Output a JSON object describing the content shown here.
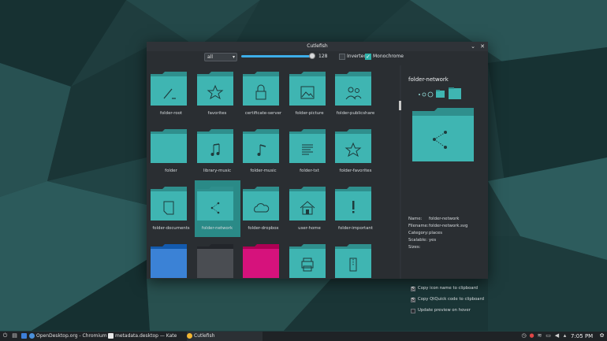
{
  "window": {
    "title": "Cutlefish",
    "minimize_glyph": "⌄",
    "close_glyph": "✕"
  },
  "toolbar": {
    "category_select": "all",
    "size_value": "128",
    "inverted_label": "Inverted",
    "inverted_checked": false,
    "monochrome_label": "Monochrome",
    "monochrome_checked": true
  },
  "icons": [
    {
      "label": "folder-root",
      "glyph": "slash"
    },
    {
      "label": "favorites",
      "glyph": "star"
    },
    {
      "label": "certificate-server",
      "glyph": "lock"
    },
    {
      "label": "folder-picture",
      "glyph": "picture"
    },
    {
      "label": "folder-publicshare",
      "glyph": "people"
    },
    {
      "label": "folder",
      "glyph": "none"
    },
    {
      "label": "library-music",
      "glyph": "note"
    },
    {
      "label": "folder-music",
      "glyph": "note2"
    },
    {
      "label": "folder-txt",
      "glyph": "lines"
    },
    {
      "label": "folder-favorites",
      "glyph": "star"
    },
    {
      "label": "folder-documents",
      "glyph": "doc"
    },
    {
      "label": "folder-network",
      "glyph": "network",
      "selected": true
    },
    {
      "label": "folder-dropbox",
      "glyph": "cloud"
    },
    {
      "label": "user-home",
      "glyph": "home"
    },
    {
      "label": "folder-important",
      "glyph": "exclaim"
    },
    {
      "label": "",
      "glyph": "none",
      "color": "#3b82d6"
    },
    {
      "label": "",
      "glyph": "none",
      "color": "#4a4d52"
    },
    {
      "label": "",
      "glyph": "none",
      "color": "#d6127c"
    },
    {
      "label": "",
      "glyph": "printer"
    },
    {
      "label": "",
      "glyph": "zip"
    }
  ],
  "preview": {
    "title": "folder-network",
    "name_key": "Name:",
    "name_val": "folder-network",
    "filename_key": "Filename:",
    "filename_val": "folder-network.svg",
    "category_key": "Category:",
    "category_val": "places",
    "scalable_key": "Scalable:",
    "scalable_val": "yes",
    "sizes_key": "Sizes:",
    "sizes_val": "",
    "copy_name_label": "Copy icon name to clipboard",
    "copy_qtquick_label": "Copy QtQuick code to clipboard",
    "update_hover_label": "Update preview on hover"
  },
  "taskbar": {
    "task1": "OpenDesktop.org - Chromium",
    "task2": "metadata.desktop — Kate",
    "task3": "Cutlefish",
    "clock": "7:05 PM"
  },
  "colors": {
    "folder_teal": "#3fb5b2",
    "folder_tab": "#2f8f8d",
    "accent": "#3daee9",
    "selection": "#2a8a87"
  }
}
